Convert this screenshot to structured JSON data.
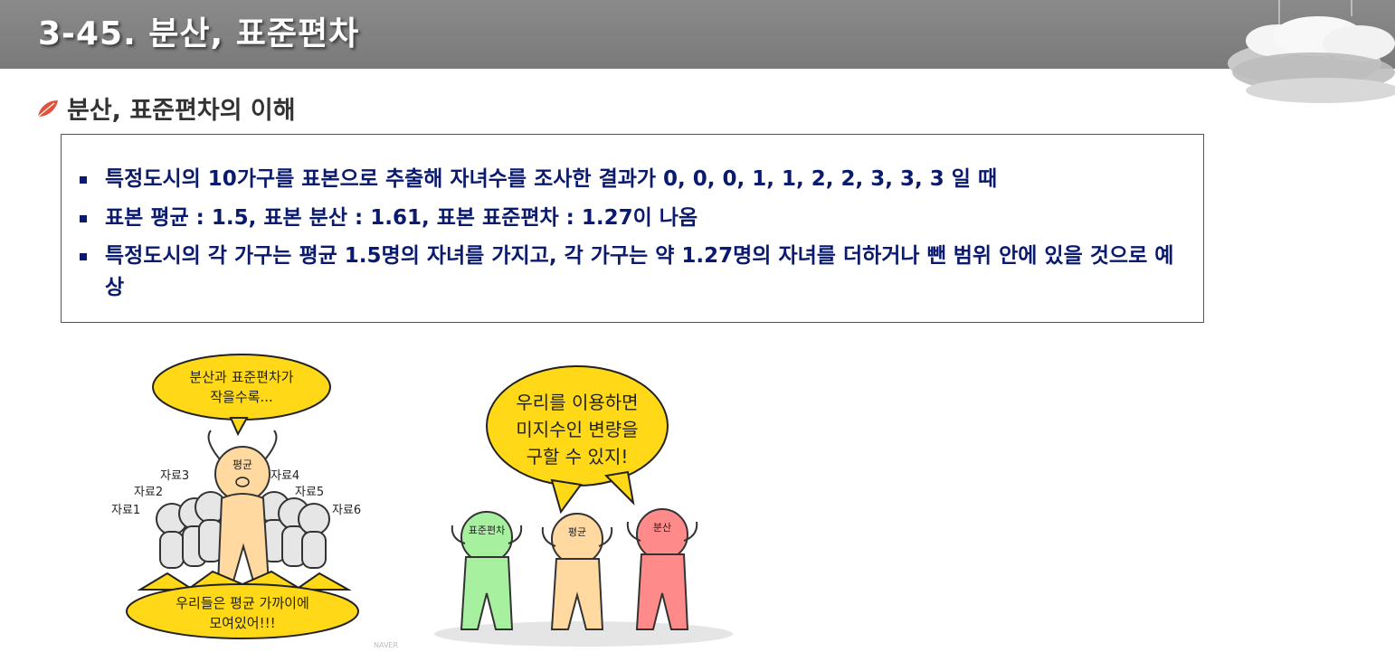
{
  "header": {
    "title": "3-45. 분산, 표준편차"
  },
  "section": {
    "title": "분산, 표준편차의 이해"
  },
  "bullets": [
    "특정도시의 10가구를 표본으로 추출해 자녀수를 조사한 결과가  0, 0, 0, 1, 1, 2, 2, 3, 3, 3 일 때",
    "표본 평균 : 1.5, 표본 분산 : 1.61, 표본 표준편차 : 1.27이 나옴",
    "특정도시의 각 가구는 평균 1.5명의 자녀를 가지고, 각 가구는 약 1.27명의 자녀를 더하거나 뺀 범위 안에 있을 것으로 예상"
  ],
  "cartoon1": {
    "top_bubble": [
      "분산과 표준편차가",
      "작을수록..."
    ],
    "center_label": "평균",
    "data_labels": [
      "자료1",
      "자료2",
      "자료3",
      "자료4",
      "자료5",
      "자료6"
    ],
    "bottom_bubble": [
      "우리들은 평균 가까이에",
      "모여있어!!!"
    ],
    "watermark": "NAVER"
  },
  "cartoon2": {
    "bubble": [
      "우리를 이용하면",
      "미지수인 변량을",
      "구할 수 있지!"
    ],
    "labels": [
      "표준편차",
      "평균",
      "분산"
    ]
  },
  "colors": {
    "header_bg": "#7f7f7f",
    "bullet_text": "#0a1a6e",
    "bubble_yellow": "#ffd817",
    "char_green": "#a6f0a0",
    "char_orange": "#ffd9a0",
    "char_red": "#ff8a8a"
  }
}
